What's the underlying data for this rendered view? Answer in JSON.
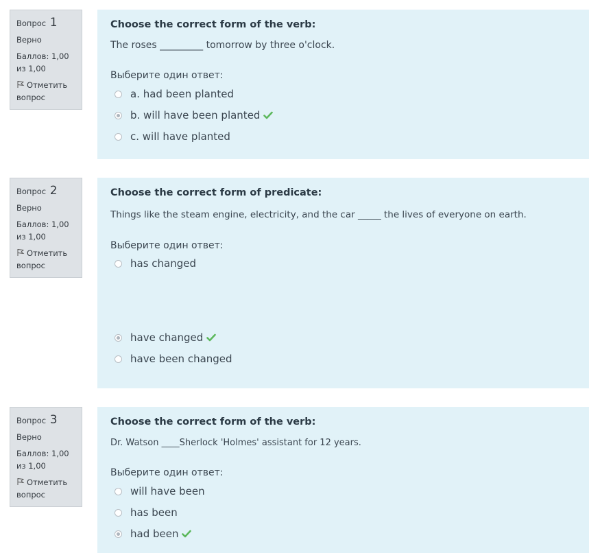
{
  "questions": [
    {
      "label": "Вопрос",
      "number": "1",
      "status": "Верно",
      "grade": "Баллов: 1,00 из 1,00",
      "flag_label": "Отметить вопрос",
      "title": "Choose the correct form of the verb:",
      "text": "The roses _________ tomorrow by three o'clock.",
      "prompt": "Выберите один ответ:",
      "answers": [
        {
          "label": "a. had been planted",
          "selected": false,
          "correct": false
        },
        {
          "label": "b. will have been planted",
          "selected": true,
          "correct": true
        },
        {
          "label": "c. will have planted",
          "selected": false,
          "correct": false
        }
      ]
    },
    {
      "label": "Вопрос",
      "number": "2",
      "status": "Верно",
      "grade": "Баллов: 1,00 из 1,00",
      "flag_label": "Отметить вопрос",
      "title": "Choose the correct form of predicate:",
      "text": "Things like the steam engine, electricity, and the car _____ the lives of everyone on earth.",
      "prompt": "Выберите один ответ:",
      "answers": [
        {
          "label": "has changed",
          "selected": false,
          "correct": false
        },
        {
          "label": "have changed",
          "selected": true,
          "correct": true
        },
        {
          "label": "have been changed",
          "selected": false,
          "correct": false
        }
      ]
    },
    {
      "label": "Вопрос",
      "number": "3",
      "status": "Верно",
      "grade": "Баллов: 1,00 из 1,00",
      "flag_label": "Отметить вопрос",
      "title": "Choose the correct form of the verb:",
      "text": "Dr. Watson ____Sherlock 'Holmes' assistant for 12 years.",
      "prompt": "Выберите один ответ:",
      "answers": [
        {
          "label": "will have been",
          "selected": false,
          "correct": false
        },
        {
          "label": "has been",
          "selected": false,
          "correct": false
        },
        {
          "label": "had been",
          "selected": true,
          "correct": true
        }
      ]
    }
  ],
  "colors": {
    "check": "#5cb85c",
    "content_bg": "#e1f2f8",
    "info_bg": "#dee2e6"
  }
}
